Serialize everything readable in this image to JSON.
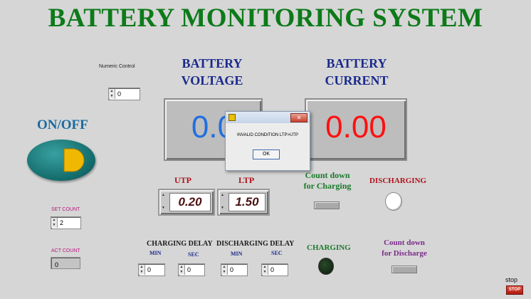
{
  "title": "BATTERY MONITORING SYSTEM",
  "numeric_control": {
    "label": "Numeric Control",
    "value": "0"
  },
  "voltage": {
    "label_line1": "BATTERY",
    "label_line2": "VOLTAGE",
    "value": "0.0"
  },
  "current": {
    "label_line1": "BATTERY",
    "label_line2": "CURRENT",
    "value": "0.00"
  },
  "on_off": {
    "label": "ON/OFF"
  },
  "dialog": {
    "message": "INVALID CONDITION LTP>UTP",
    "ok_label": "OK"
  },
  "utp": {
    "label": "UTP",
    "value": "0.20"
  },
  "ltp": {
    "label": "LTP",
    "value": "1.50"
  },
  "countdown_charging": {
    "line1": "Count down",
    "line2": "for Charging"
  },
  "discharging": {
    "label": "DISCHARGING"
  },
  "set_count": {
    "label": "SET COUNT",
    "value": "2"
  },
  "act_count": {
    "label": "ACT COUNT",
    "value": "0"
  },
  "charging_delay": {
    "label": "CHARGING DELAY",
    "min_label": "MIN",
    "sec_label": "SEC",
    "min_value": "0",
    "sec_value": "0"
  },
  "discharging_delay": {
    "label": "DISCHARGING DELAY",
    "min_label": "MIN",
    "sec_label": "SEC",
    "min_value": "0",
    "sec_value": "0"
  },
  "charging": {
    "label": "CHARGING"
  },
  "countdown_discharge": {
    "line1": "Count down",
    "line2": "for Discharge"
  },
  "stop": {
    "label": "stop",
    "button_label": "STOP"
  },
  "colors": {
    "title": "#0d7a1a",
    "voltage_digits": "#1f6fe0",
    "current_digits": "#ff1010",
    "labels_blue": "#1a2a8c",
    "labels_red": "#b0121c",
    "green_text": "#1a7a2a",
    "purple_text": "#7a2a8a"
  }
}
